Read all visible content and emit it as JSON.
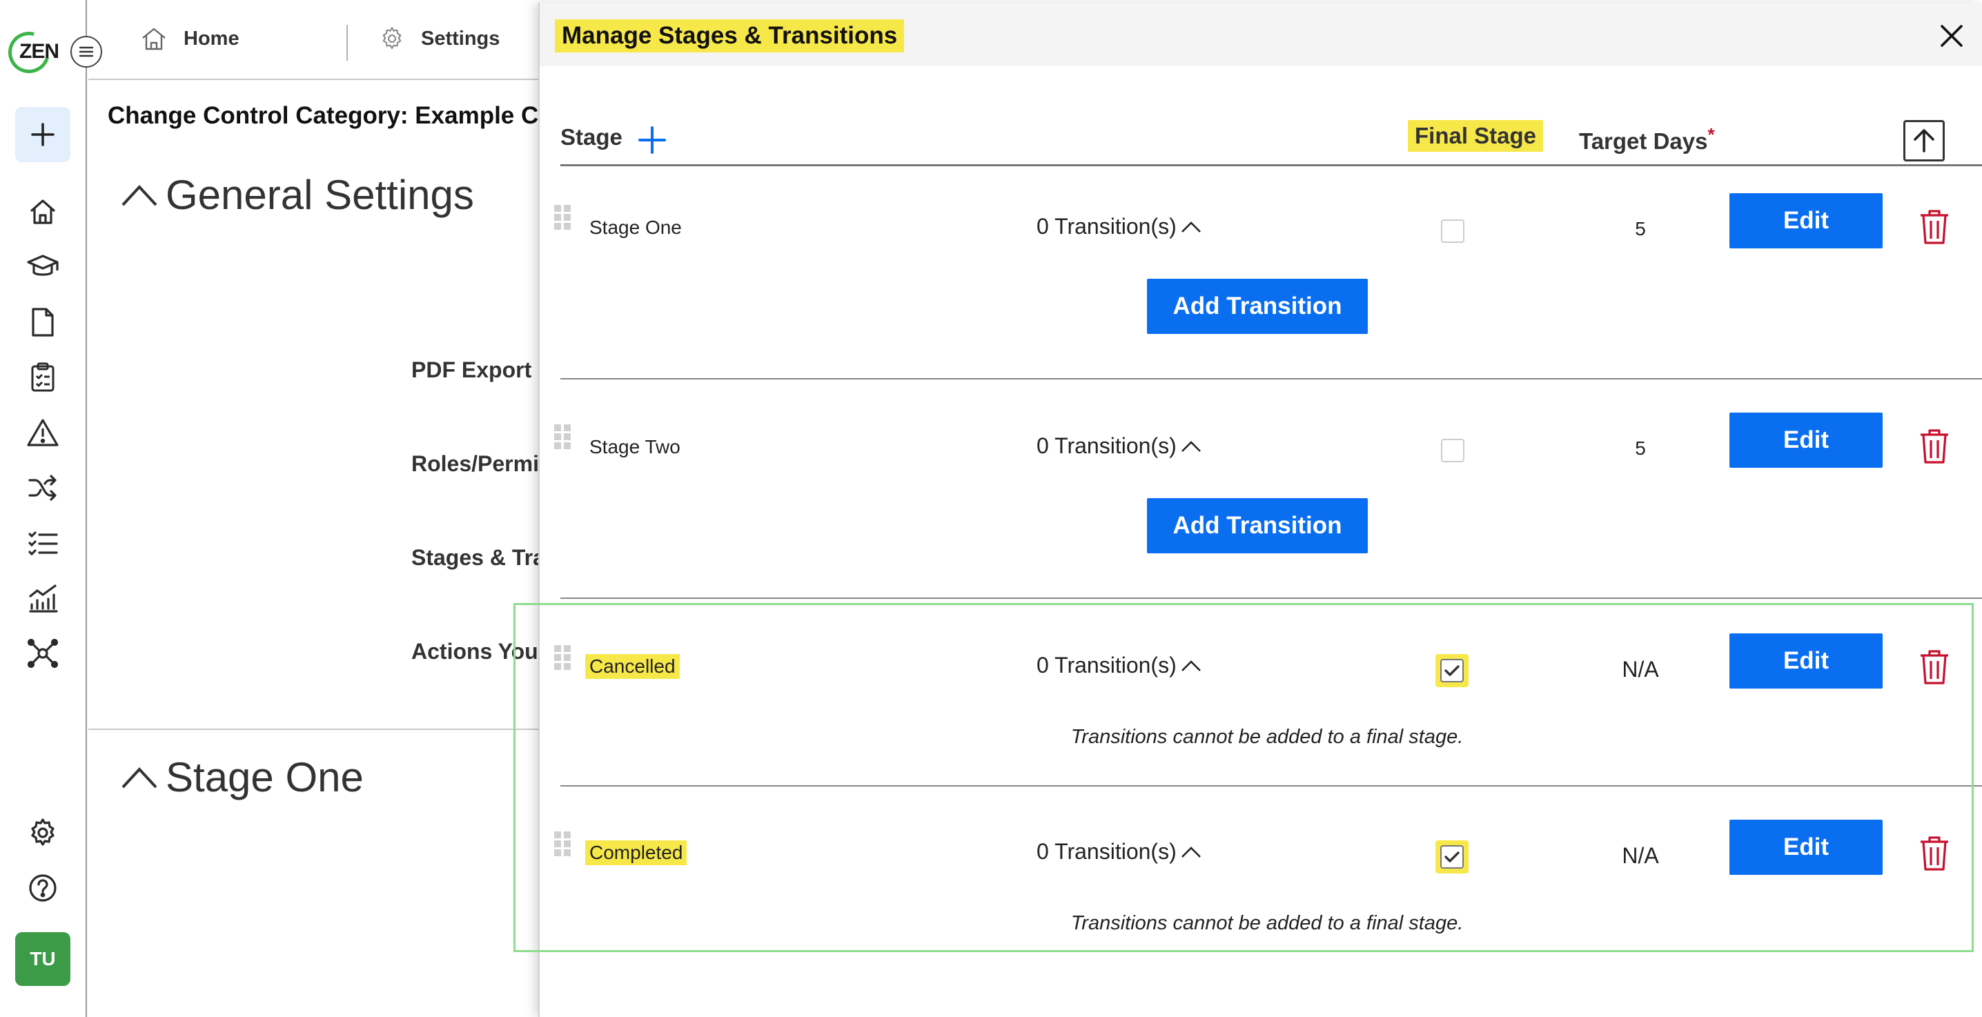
{
  "nav": {
    "logo_text": "ZEN",
    "avatar_initials": "TU",
    "items": [
      "home-icon",
      "learning-icon",
      "document-icon",
      "checklist-icon",
      "warning-icon",
      "shuffle-icon",
      "list-icon",
      "analytics-icon",
      "network-icon"
    ],
    "bottom": [
      "gear-icon",
      "help-icon"
    ]
  },
  "breadcrumb": {
    "home": "Home",
    "settings": "Settings"
  },
  "page": {
    "title": "Change Control Category: Example Cha",
    "section_general": "General Settings",
    "section_stage_one": "Stage One",
    "settings_labels": [
      "PDF Export (",
      "Roles/Permi",
      "Stages & Tra",
      "Actions You"
    ]
  },
  "drawer": {
    "title": "Manage Stages & Transitions",
    "col_stage": "Stage",
    "col_final_stage": "Final Stage",
    "col_target_days": "Target Days",
    "required_mark": "*",
    "edit_label": "Edit",
    "add_transition_label": "Add Transition",
    "final_note": "Transitions cannot be added to a final stage.",
    "stages": [
      {
        "name": "Stage One",
        "transitions": "0 Transition(s)",
        "final": false,
        "target_days": "5"
      },
      {
        "name": "Stage Two",
        "transitions": "0 Transition(s)",
        "final": false,
        "target_days": "5"
      },
      {
        "name": "Cancelled",
        "transitions": "0 Transition(s)",
        "final": true,
        "target_days": "N/A"
      },
      {
        "name": "Completed",
        "transitions": "0 Transition(s)",
        "final": true,
        "target_days": "N/A"
      }
    ]
  },
  "colors": {
    "primary": "#0a6ef0",
    "highlight": "#f7e84a",
    "danger": "#c8102e",
    "selection": "#8edc8e",
    "brand_green": "#3b9b47"
  }
}
